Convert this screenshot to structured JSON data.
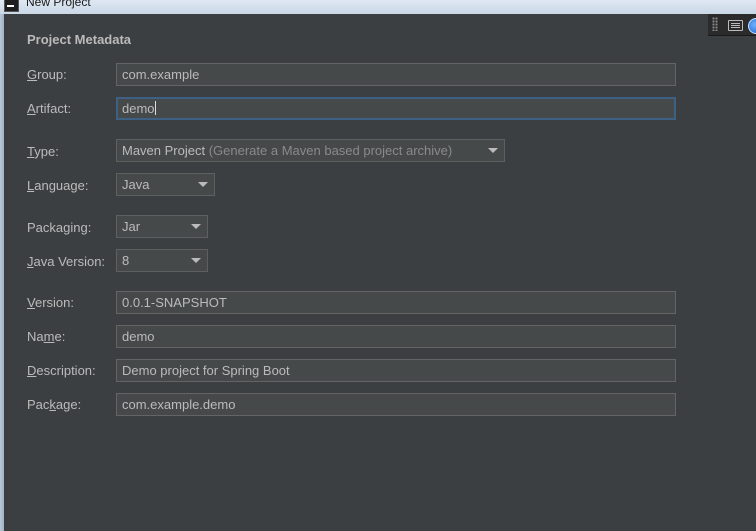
{
  "window": {
    "title": "New Project"
  },
  "section": {
    "title": "Project Metadata"
  },
  "form": {
    "group": {
      "label_mn": "G",
      "label_rest": "roup:",
      "value": "com.example"
    },
    "artifact": {
      "label_mn": "A",
      "label_rest": "rtifact:",
      "value": "demo"
    },
    "type": {
      "label_mn": "T",
      "label_rest": "ype:",
      "value": "Maven Project",
      "hint": "(Generate a Maven based project archive)"
    },
    "language": {
      "label_mn": "L",
      "label_rest": "anguage:",
      "value": "Java"
    },
    "packaging": {
      "label_pre": "Packa",
      "label_mn": "g",
      "label_rest": "ing:",
      "value": "Jar"
    },
    "java_version": {
      "label_mn": "J",
      "label_rest": "ava Version:",
      "value": "8"
    },
    "version": {
      "label_mn": "V",
      "label_rest": "ersion:",
      "value": "0.0.1-SNAPSHOT"
    },
    "name": {
      "label_pre": "Na",
      "label_mn": "m",
      "label_rest": "e:",
      "value": "demo"
    },
    "description": {
      "label_mn": "D",
      "label_rest": "escription:",
      "value": "Demo project for Spring Boot"
    },
    "package": {
      "label_pre": "Pac",
      "label_mn": "k",
      "label_rest": "age:",
      "value": "com.example.demo"
    }
  }
}
